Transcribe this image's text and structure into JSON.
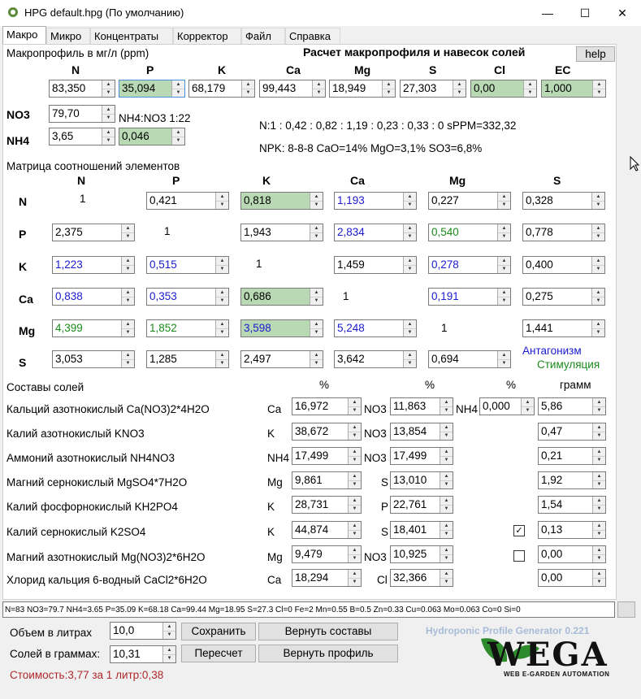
{
  "window": {
    "title": "HPG default.hpg (По умолчанию)",
    "minimize": "—",
    "maximize": "☐",
    "close": "✕"
  },
  "tabs": [
    "Макро",
    "Микро",
    "Концентраты",
    "Корректор",
    "Файл",
    "Справка"
  ],
  "macro": {
    "profile_label": "Макропрофиль в мг/л (ppm)",
    "heading": "Расчет макропрофиля и навесок солей",
    "help": "help",
    "columns": [
      "N",
      "P",
      "K",
      "Ca",
      "Mg",
      "S",
      "Cl",
      "EC"
    ],
    "values": [
      "83,350",
      "35,094",
      "68,179",
      "99,443",
      "18,949",
      "27,303",
      "0,00",
      "1,000"
    ],
    "no3_label": "NO3",
    "no3_value": "79,70",
    "nh4_label": "NH4",
    "nh4_value": "3,65",
    "nh4no3_label": "NH4:NO3 1:22",
    "nh4no3_value": "0,046",
    "ratio_line": "N:1 : 0,42 : 0,82 : 1,19 : 0,23 : 0,33 : 0 sPPM=332,32",
    "npk_line": "NPK: 8-8-8 CaO=14% MgO=3,1% SO3=6,8%"
  },
  "matrix": {
    "title": "Матрица соотношений элементов",
    "col_headers": [
      "N",
      "P",
      "K",
      "Ca",
      "Mg",
      "S"
    ],
    "row_headers": [
      "N",
      "P",
      "K",
      "Ca",
      "Mg",
      "S"
    ],
    "rows": [
      [
        "1",
        "0,421",
        "0,818",
        "1,193",
        "0,227",
        "0,328"
      ],
      [
        "2,375",
        "1",
        "1,943",
        "2,834",
        "0,540",
        "0,778"
      ],
      [
        "1,223",
        "0,515",
        "1",
        "1,459",
        "0,278",
        "0,400"
      ],
      [
        "0,838",
        "0,353",
        "0,686",
        "1",
        "0,191",
        "0,275"
      ],
      [
        "4,399",
        "1,852",
        "3,598",
        "5,248",
        "1",
        "1,441"
      ],
      [
        "3,053",
        "1,285",
        "2,497",
        "3,642",
        "0,694",
        ""
      ]
    ],
    "antagonism": "Антагонизм",
    "stimulation": "Стимуляция"
  },
  "salts": {
    "title": "Составы солей",
    "pct": "%",
    "gram": "грамм",
    "items": [
      {
        "name": "Кальций азотнокислый Ca(NO3)2*4H2O",
        "e1": "Ca",
        "v1": "16,972",
        "e2": "NO3",
        "v2": "11,863",
        "e3": "NH4",
        "v3": "0,000",
        "g": "5,86"
      },
      {
        "name": "Калий азотнокислый KNO3",
        "e1": "K",
        "v1": "38,672",
        "e2": "NO3",
        "v2": "13,854",
        "g": "0,47"
      },
      {
        "name": "Аммоний азотнокислый NH4NO3",
        "e1": "NH4",
        "v1": "17,499",
        "e2": "NO3",
        "v2": "17,499",
        "g": "0,21"
      },
      {
        "name": "Магний сернокислый MgSO4*7H2O",
        "e1": "Mg",
        "v1": "9,861",
        "e2": "S",
        "v2": "13,010",
        "g": "1,92"
      },
      {
        "name": "Калий фосфорнокислый KH2PO4",
        "e1": "K",
        "v1": "28,731",
        "e2": "P",
        "v2": "22,761",
        "g": "1,54"
      },
      {
        "name": "Калий сернокислый K2SO4",
        "e1": "K",
        "v1": "44,874",
        "e2": "S",
        "v2": "18,401",
        "check": "✓",
        "g": "0,13"
      },
      {
        "name": "Магний азотнокислый Mg(NO3)2*6H2O",
        "e1": "Mg",
        "v1": "9,479",
        "e2": "NO3",
        "v2": "10,925",
        "check": "",
        "g": "0,00"
      },
      {
        "name": "Хлорид кальция 6-водный CaCl2*6H2O",
        "e1": "Ca",
        "v1": "18,294",
        "e2": "Cl",
        "v2": "32,366",
        "g": "0,00"
      }
    ]
  },
  "status_line": "N=83 NO3=79.7 NH4=3.65 P=35.09 K=68.18 Ca=99.44 Mg=18.95 S=27.3 Cl=0 Fe=2 Mn=0.55 B=0.5 Zn=0.33 Cu=0.063 Mo=0.063 Co=0 Si=0",
  "bottom": {
    "volume_label": "Объем в литрах",
    "volume_value": "10,0",
    "salts_label": "Солей в граммах:",
    "salts_value": "10,31",
    "save": "Сохранить",
    "recalc": "Пересчет",
    "restore_salts": "Вернуть составы",
    "restore_profile": "Вернуть профиль",
    "cost": "Стоимость:3,77 за 1 литр:0,38",
    "generator": "Hydroponic Profile Generator 0.221",
    "logo": "WEGA",
    "logo_sub": "WEB E-GARDEN AUTOMATION"
  }
}
